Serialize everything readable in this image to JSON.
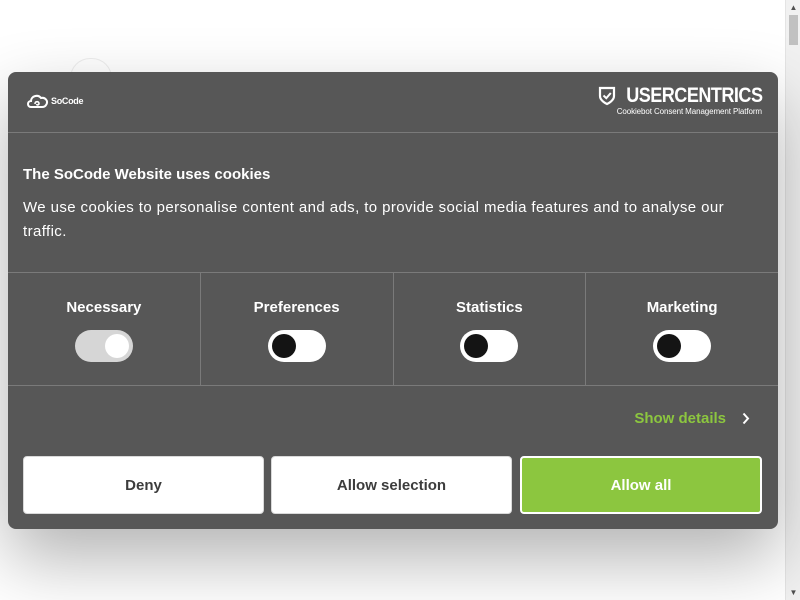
{
  "header": {
    "brand_name": "SoCode",
    "uc_wordmark": "USERCENTRICS",
    "uc_subtitle": "Cookiebot Consent Management Platform"
  },
  "body": {
    "title": "The SoCode Website uses cookies",
    "description": "We use cookies to personalise content and ads, to provide social media features and to analyse our traffic."
  },
  "categories": [
    {
      "label": "Necessary",
      "state": "on",
      "disabled": true
    },
    {
      "label": "Preferences",
      "state": "off",
      "disabled": false
    },
    {
      "label": "Statistics",
      "state": "off",
      "disabled": false
    },
    {
      "label": "Marketing",
      "state": "off",
      "disabled": false
    }
  ],
  "details": {
    "show_details_label": "Show details"
  },
  "buttons": {
    "deny_label": "Deny",
    "allow_selection_label": "Allow selection",
    "allow_all_label": "Allow all"
  },
  "colors": {
    "dialog_bg": "#575757",
    "accent_green": "#8cc63f",
    "divider": "#7a7a7a",
    "text": "#ffffff"
  },
  "icons": {
    "brand": "cloud-spiral-icon",
    "uc_shield": "shield-check-icon",
    "details": "chevron-right-icon"
  }
}
